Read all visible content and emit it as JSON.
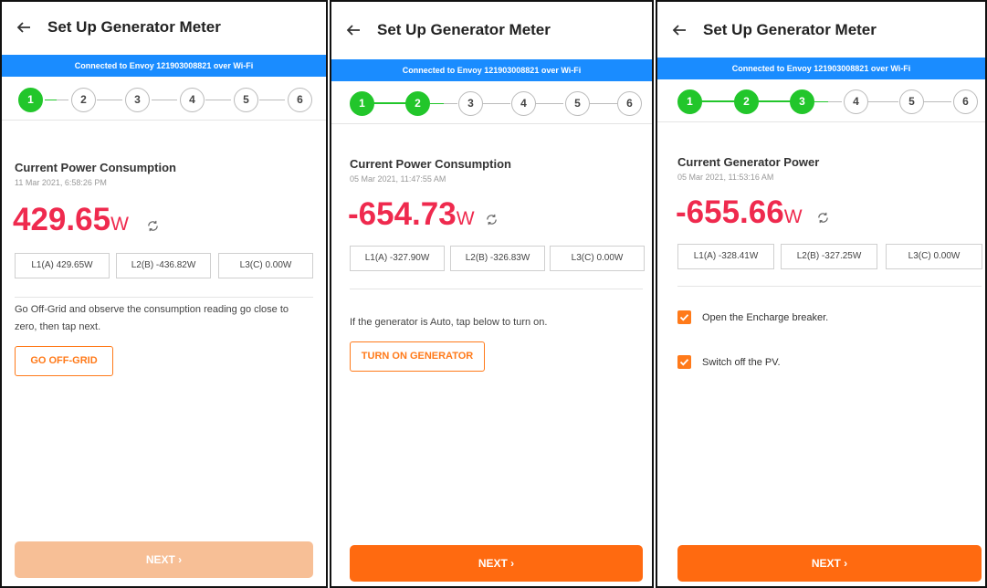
{
  "colors": {
    "accent_orange": "#ff7a1a",
    "step_done_green": "#22c62b",
    "wifi_blue": "#1a8cff",
    "value_red": "#ef2a4e"
  },
  "screens": [
    {
      "title": "Set Up Generator Meter",
      "wifi_status": "Connected to Envoy 121903008821 over Wi-Fi",
      "steps": [
        "1",
        "2",
        "3",
        "4",
        "5",
        "6"
      ],
      "steps_completed": 1,
      "section_title": "Current Power Consumption",
      "timestamp": "11 Mar 2021, 6:58:26 PM",
      "value": "429.65",
      "unit": "W",
      "phases": [
        "L1(A) 429.65W",
        "L2(B) -436.82W",
        "L3(C) 0.00W"
      ],
      "instruction": "Go Off-Grid and observe the consumption reading go close to zero, then tap next.",
      "action_button": "GO OFF-GRID",
      "next_button": "NEXT ›",
      "next_enabled": false
    },
    {
      "title": "Set Up Generator Meter",
      "wifi_status": "Connected to Envoy 121903008821 over Wi-Fi",
      "steps": [
        "1",
        "2",
        "3",
        "4",
        "5",
        "6"
      ],
      "steps_completed": 2,
      "section_title": "Current Power Consumption",
      "timestamp": "05 Mar 2021, 11:47:55 AM",
      "value": "-654.73",
      "unit": "W",
      "phases": [
        "L1(A) -327.90W",
        "L2(B) -326.83W",
        "L3(C) 0.00W"
      ],
      "instruction": "If the generator is Auto, tap below to turn on.",
      "action_button": "TURN ON GENERATOR",
      "next_button": "NEXT ›",
      "next_enabled": true
    },
    {
      "title": "Set Up Generator Meter",
      "wifi_status": "Connected to Envoy 121903008821 over Wi-Fi",
      "steps": [
        "1",
        "2",
        "3",
        "4",
        "5",
        "6"
      ],
      "steps_completed": 3,
      "section_title": "Current Generator Power",
      "timestamp": "05 Mar 2021, 11:53:16 AM",
      "value": "-655.66",
      "unit": "W",
      "phases": [
        "L1(A) -328.41W",
        "L2(B) -327.25W",
        "L3(C) 0.00W"
      ],
      "checklist": [
        {
          "label": "Open the Encharge breaker.",
          "checked": true
        },
        {
          "label": "Switch off the PV.",
          "checked": true
        }
      ],
      "next_button": "NEXT ›",
      "next_enabled": true
    }
  ]
}
